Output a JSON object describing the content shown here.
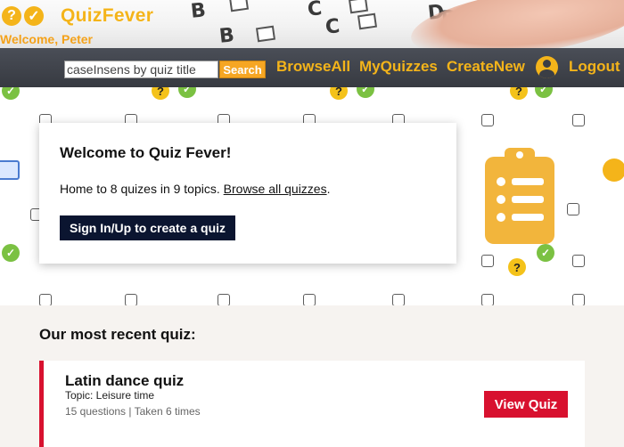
{
  "header": {
    "brand": "QuizFever",
    "welcome": "Welcome, Peter",
    "logo_icons": [
      "question-icon",
      "check-icon"
    ]
  },
  "nav": {
    "search_placeholder": "caseInsens by quiz title",
    "search_label": "Search",
    "links": {
      "browse_all": "BrowseAll",
      "my_quizzes": "MyQuizzes",
      "create_new": "CreateNew",
      "logout": "Logout"
    }
  },
  "hero": {
    "title": "Welcome to Quiz Fever!",
    "text_prefix": "Home to 8 quizes in 9 topics. ",
    "browse_link": "Browse all quizzes",
    "text_suffix": ".",
    "signin_label": "Sign In/Up to create a quiz"
  },
  "recent": {
    "heading": "Our most recent quiz:",
    "quiz": {
      "name": "Latin dance quiz",
      "topic": "Topic: Leisure time",
      "stats": "15 questions | Taken 6 times",
      "view_label": "View Quiz"
    }
  },
  "colors": {
    "brand": "#f4b41a",
    "nav_bg": "#3b3e45",
    "accent_red": "#d8112f",
    "dark_button": "#0b1530"
  }
}
